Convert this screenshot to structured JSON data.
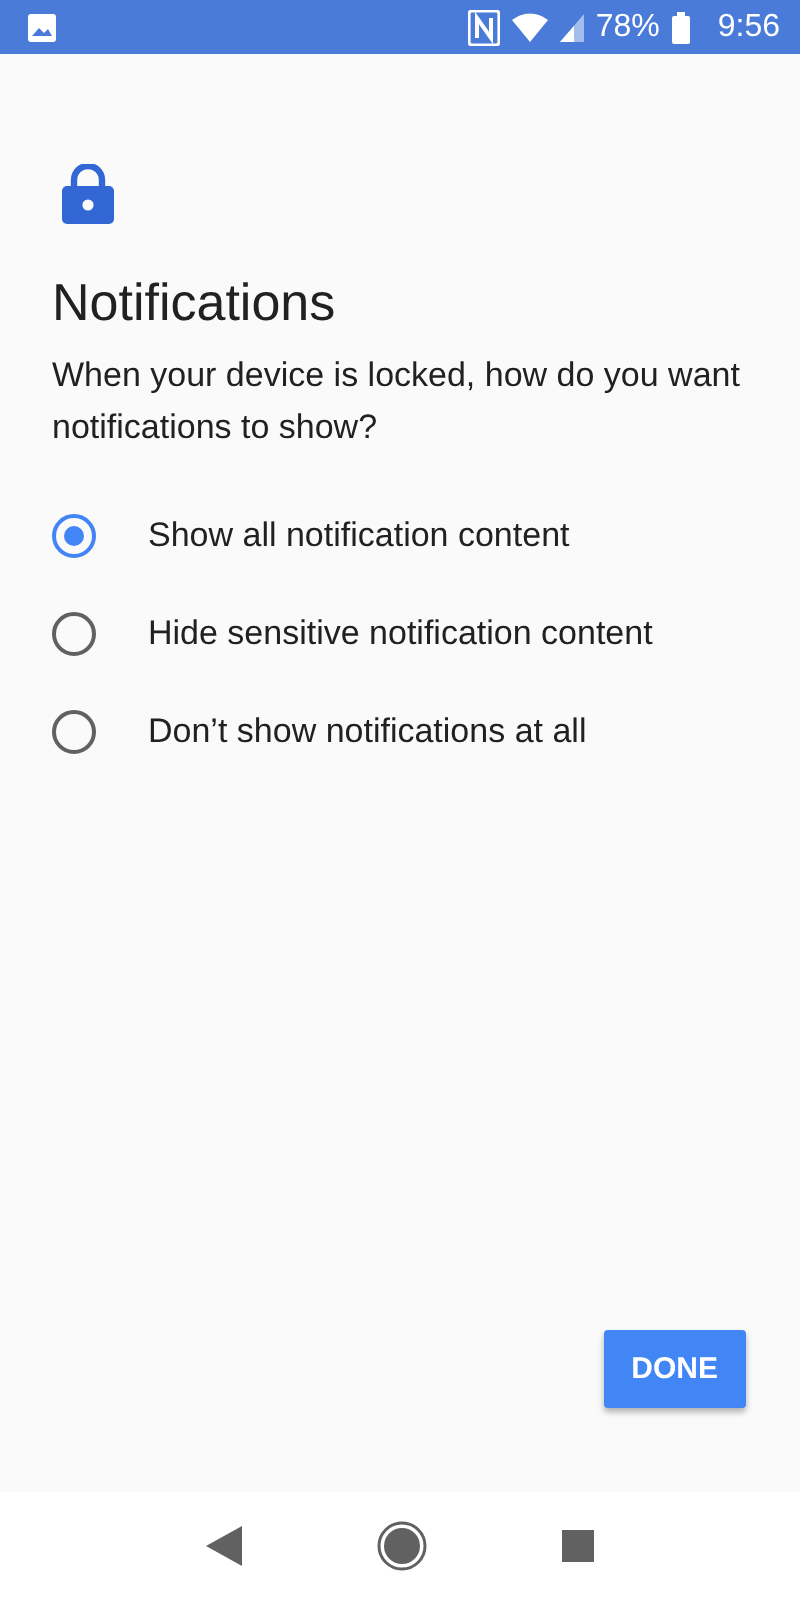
{
  "status_bar": {
    "battery": "78%",
    "time": "9:56"
  },
  "title": "Notifications",
  "question": "When your device is locked, how do you want notifications to show?",
  "options": [
    {
      "label": "Show all notification content",
      "selected": true
    },
    {
      "label": "Hide sensitive notification content",
      "selected": false
    },
    {
      "label": "Don’t show notifications at all",
      "selected": false
    }
  ],
  "done_button": "DONE"
}
